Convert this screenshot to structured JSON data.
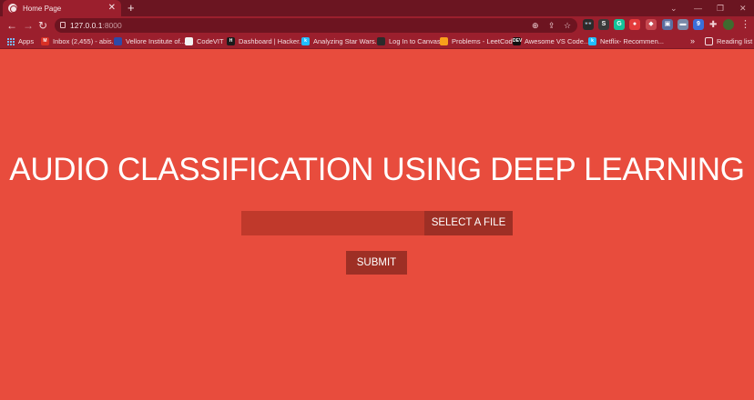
{
  "browser": {
    "tab": {
      "title": "Home Page",
      "close_glyph": "✕"
    },
    "new_tab_glyph": "+",
    "window_controls": [
      "⌄",
      "—",
      "❐",
      "✕"
    ],
    "nav": {
      "back_glyph": "←",
      "forward_glyph": "→",
      "reload_glyph": "↻"
    },
    "address": {
      "host": "127.0.0.1",
      "port": ":8000"
    },
    "omnibox_icons": [
      "zoom-icon",
      "share-icon",
      "bookmark-star-icon"
    ],
    "extensions": [
      {
        "name": "glasses-extension-icon",
        "glyph": "👓",
        "color": "#2b2b2b"
      },
      {
        "name": "s-extension-icon",
        "glyph": "S",
        "color": "#3a3a3a"
      },
      {
        "name": "grammarly-extension-icon",
        "glyph": "G",
        "color": "#15c39a"
      },
      {
        "name": "red-extension-icon",
        "glyph": "●",
        "color": "#e33b3b"
      },
      {
        "name": "shield-extension-icon",
        "glyph": "◆",
        "color": "#c6474f"
      },
      {
        "name": "store-extension-icon",
        "glyph": "▣",
        "color": "#5a6ea0"
      },
      {
        "name": "car-extension-icon",
        "glyph": "▬",
        "color": "#7a8aa8"
      },
      {
        "name": "badge-extension-icon",
        "glyph": "9",
        "color": "#3b6fd9"
      }
    ],
    "puzzle_glyph": "✚",
    "menu_glyph": "⋮",
    "bookmarks": [
      {
        "label": "Apps",
        "icon": "apps-icon",
        "color": "#7ab8f5"
      },
      {
        "label": "Inbox (2,455) - abis...",
        "icon": "gmail-icon",
        "color": "#d93025"
      },
      {
        "label": "Vellore Institute of...",
        "icon": "vit-icon",
        "color": "#2d4aa8"
      },
      {
        "label": "CodeVIT",
        "icon": "codevit-icon",
        "color": "#f2f2f2"
      },
      {
        "label": "Dashboard | Hacker...",
        "icon": "hackerrank-icon",
        "color": "#1b1b1b"
      },
      {
        "label": "Analyzing Star Wars...",
        "icon": "kaggle-icon",
        "color": "#20beff"
      },
      {
        "label": "Log In to Canvas",
        "icon": "canvas-icon",
        "color": "#2b2b2b"
      },
      {
        "label": "Problems - LeetCode",
        "icon": "leetcode-icon",
        "color": "#f89f1b"
      },
      {
        "label": "Awesome VS Code...",
        "icon": "dev-icon",
        "color": "#111111"
      },
      {
        "label": "Netflix- Recommen...",
        "icon": "kaggle-icon-2",
        "color": "#20beff"
      }
    ],
    "bookmarks_overflow": "»",
    "reading_list": "Reading list"
  },
  "page": {
    "title": "AUDIO CLASSIFICATION USING DEEP LEARNING",
    "file_input_value": "",
    "select_file_label": "SELECT A FILE",
    "submit_label": "SUBMIT"
  },
  "colors": {
    "page_background": "#e84c3d",
    "file_field": "#c0392b",
    "button": "#9e2f25",
    "chrome_frame": "#6b1521",
    "chrome_toolbar": "#9b1f2d"
  }
}
